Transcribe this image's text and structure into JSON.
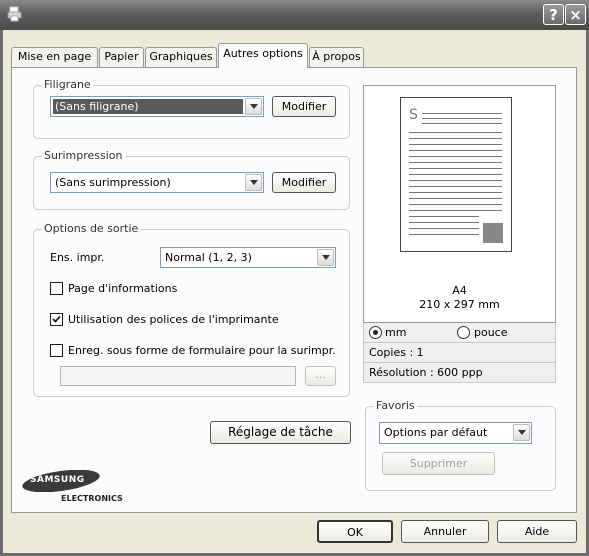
{
  "window": {
    "help_label": "?",
    "close_label": "×"
  },
  "tabs": [
    {
      "label": "Mise en page"
    },
    {
      "label": "Papier"
    },
    {
      "label": "Graphiques"
    },
    {
      "label": "Autres options",
      "active": true
    },
    {
      "label": "À propos"
    }
  ],
  "watermark": {
    "legend": "Filigrane",
    "selected": "(Sans filigrane)",
    "edit_label": "Modifier"
  },
  "overlay": {
    "legend": "Surimpression",
    "selected": "(Sans surimpression)",
    "edit_label": "Modifier"
  },
  "output": {
    "legend": "Options de sortie",
    "order_label": "Ens. impr.",
    "order_selected": "Normal (1, 2, 3)",
    "info_page_label": "Page d'informations",
    "info_page_checked": false,
    "printer_fonts_label": "Utilisation des polices de l'imprimante",
    "printer_fonts_checked": true,
    "save_form_label": "Enreg. sous forme de formulaire pour la surimpr.",
    "save_form_checked": false,
    "path_value": "",
    "browse_label": "..."
  },
  "job_settings_label": "Réglage de tâche",
  "preview": {
    "page_letter": "S",
    "paper_name": "A4",
    "paper_size": "210 x 297 mm",
    "unit_mm": "mm",
    "unit_inch": "pouce",
    "unit_selected": "mm",
    "copies": "Copies : 1",
    "resolution": "Résolution : 600 ppp"
  },
  "favorites": {
    "legend": "Favoris",
    "selected": "Options par défaut",
    "delete_label": "Supprimer"
  },
  "logo": {
    "brand": "SAMSUNG",
    "sub": "ELECTRONICS"
  },
  "footer": {
    "ok_label": "OK",
    "cancel_label": "Annuler",
    "help_label": "Aide"
  },
  "colors": {
    "title_bar": "#5e5e5e",
    "dialog_bg": "#ece9d8",
    "panel_bg": "#fcfcfe",
    "highlight": "#5a5a5a"
  }
}
